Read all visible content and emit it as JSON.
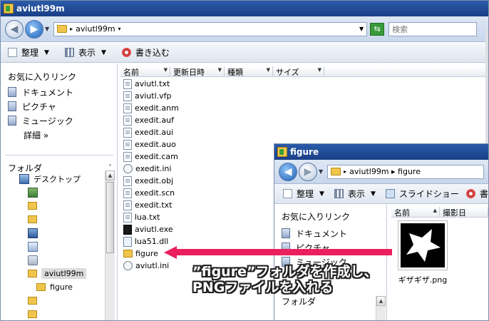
{
  "main_window": {
    "title": "aviutl99m",
    "address_path": "aviutl99m",
    "search_placeholder": "検索",
    "toolbar": {
      "organize": "整理",
      "view": "表示",
      "burn": "書き込む"
    },
    "favorites": {
      "title": "お気に入りリンク",
      "items": [
        "ドキュメント",
        "ピクチャ",
        "ミュージック"
      ],
      "details": "詳細 »"
    },
    "folder_pane": {
      "label": "フォルダ",
      "desktop": "デスクトップ",
      "selected": "aviutl99m",
      "child": "figure"
    },
    "columns": [
      "名前",
      "更新日時",
      "種類",
      "サイズ"
    ],
    "files": [
      {
        "name": "aviutl.txt",
        "icon": "txt"
      },
      {
        "name": "aviutl.vfp",
        "icon": "txt"
      },
      {
        "name": "exedit.anm",
        "icon": "txt"
      },
      {
        "name": "exedit.auf",
        "icon": "txt"
      },
      {
        "name": "exedit.aui",
        "icon": "txt"
      },
      {
        "name": "exedit.auo",
        "icon": "txt"
      },
      {
        "name": "exedit.cam",
        "icon": "txt"
      },
      {
        "name": "exedit.ini",
        "icon": "ini"
      },
      {
        "name": "exedit.obj",
        "icon": "txt"
      },
      {
        "name": "exedit.scn",
        "icon": "txt"
      },
      {
        "name": "exedit.txt",
        "icon": "txt"
      },
      {
        "name": "lua.txt",
        "icon": "txt"
      },
      {
        "name": "aviutl.exe",
        "icon": "exe"
      },
      {
        "name": "lua51.dll",
        "icon": "dll"
      },
      {
        "name": "figure",
        "icon": "folder"
      },
      {
        "name": "aviutl.ini",
        "icon": "ini"
      }
    ]
  },
  "figure_window": {
    "title": "figure",
    "address_path": "aviutl99m ▸ figure",
    "toolbar": {
      "organize": "整理",
      "view": "表示",
      "slideshow": "スライドショー",
      "burn": "書"
    },
    "favorites": {
      "title": "お気に入りリンク",
      "items": [
        "ドキュメント",
        "ピクチャ",
        "ミュージック"
      ]
    },
    "folder_label": "フォルダ",
    "columns": [
      "名前",
      "撮影日"
    ],
    "file": {
      "name": "ギザギザ.png"
    }
  },
  "callout": {
    "line1": "”figure”フォルダを作成し、",
    "line2": "PNGファイルを入れる",
    "color": "#ea1f5d"
  },
  "colors": {
    "title_bar": "#1f4a95",
    "folder": "#f0c54a",
    "arrow": "#ea1f5d"
  }
}
